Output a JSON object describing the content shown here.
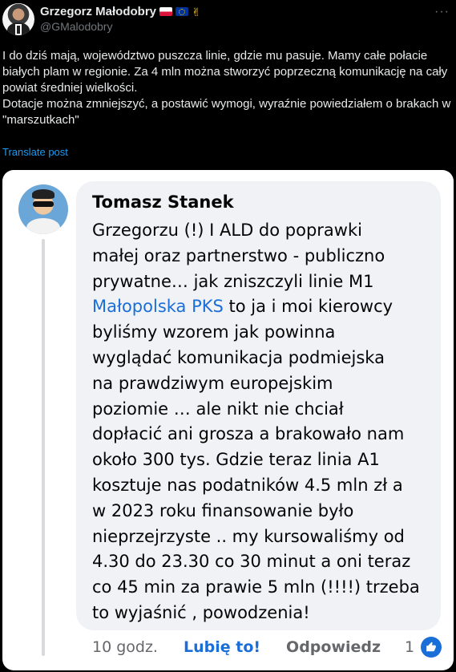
{
  "post": {
    "display_name": "Grzegorz Małodobry",
    "handle": "@GMalodobry",
    "emoji_victory": "✌",
    "more_label": "···",
    "text_lines": [
      "I do dziś mają, województwo puszcza linie, gdzie mu pasuje. Mamy całe połacie białych plam w regionie. Za 4 mln można stworzyć poprzeczną komunikację na cały powiat średniej wielkości.",
      "Dotacje można zmniejszyć, a postawić wymogi, wyraźnie powiedziałem o brakach w \"marszutkach\""
    ],
    "translate_label": "Translate post"
  },
  "comment": {
    "author": "Tomasz Stanek",
    "lines": [
      "Grzegorzu (!) I ALD do poprawki",
      "małej oraz partnerstwo - publiczno",
      "prywatne… jak zniszczyli linie M1",
      "Małopolska PKS",
      " to ja i moi kierowcy",
      "byliśmy wzorem jak powinna",
      "wyglądać komunikacja podmiejska",
      "na prawdziwym europejskim",
      "poziomie … ale nikt nie chciał",
      "dopłacić ani grosza a brakowało nam",
      "około 300 tys. Gdzie teraz linia A1",
      "kosztuje nas podatników 4.5 mln zł a",
      "w 2023 roku finansowanie było",
      "nieprzejrzyste .. my kursowaliśmy od",
      "4.30 do 23.30 co 30 minut a oni teraz",
      "co 45 min za prawie 5 mln (!!!!) trzeba",
      "to wyjaśnić , powodzenia!"
    ],
    "time": "10 godz.",
    "like_label": "Lubię to!",
    "reply_label": "Odpowiedz",
    "reaction_count": "1"
  },
  "colors": {
    "background": "#000000",
    "link_blue": "#1d9bf0",
    "fb_blue": "#1a6ed8",
    "bubble": "#f0f2f5"
  },
  "icons": {
    "more": "more-horizontal-icon",
    "like_badge": "thumbs-up-icon"
  }
}
